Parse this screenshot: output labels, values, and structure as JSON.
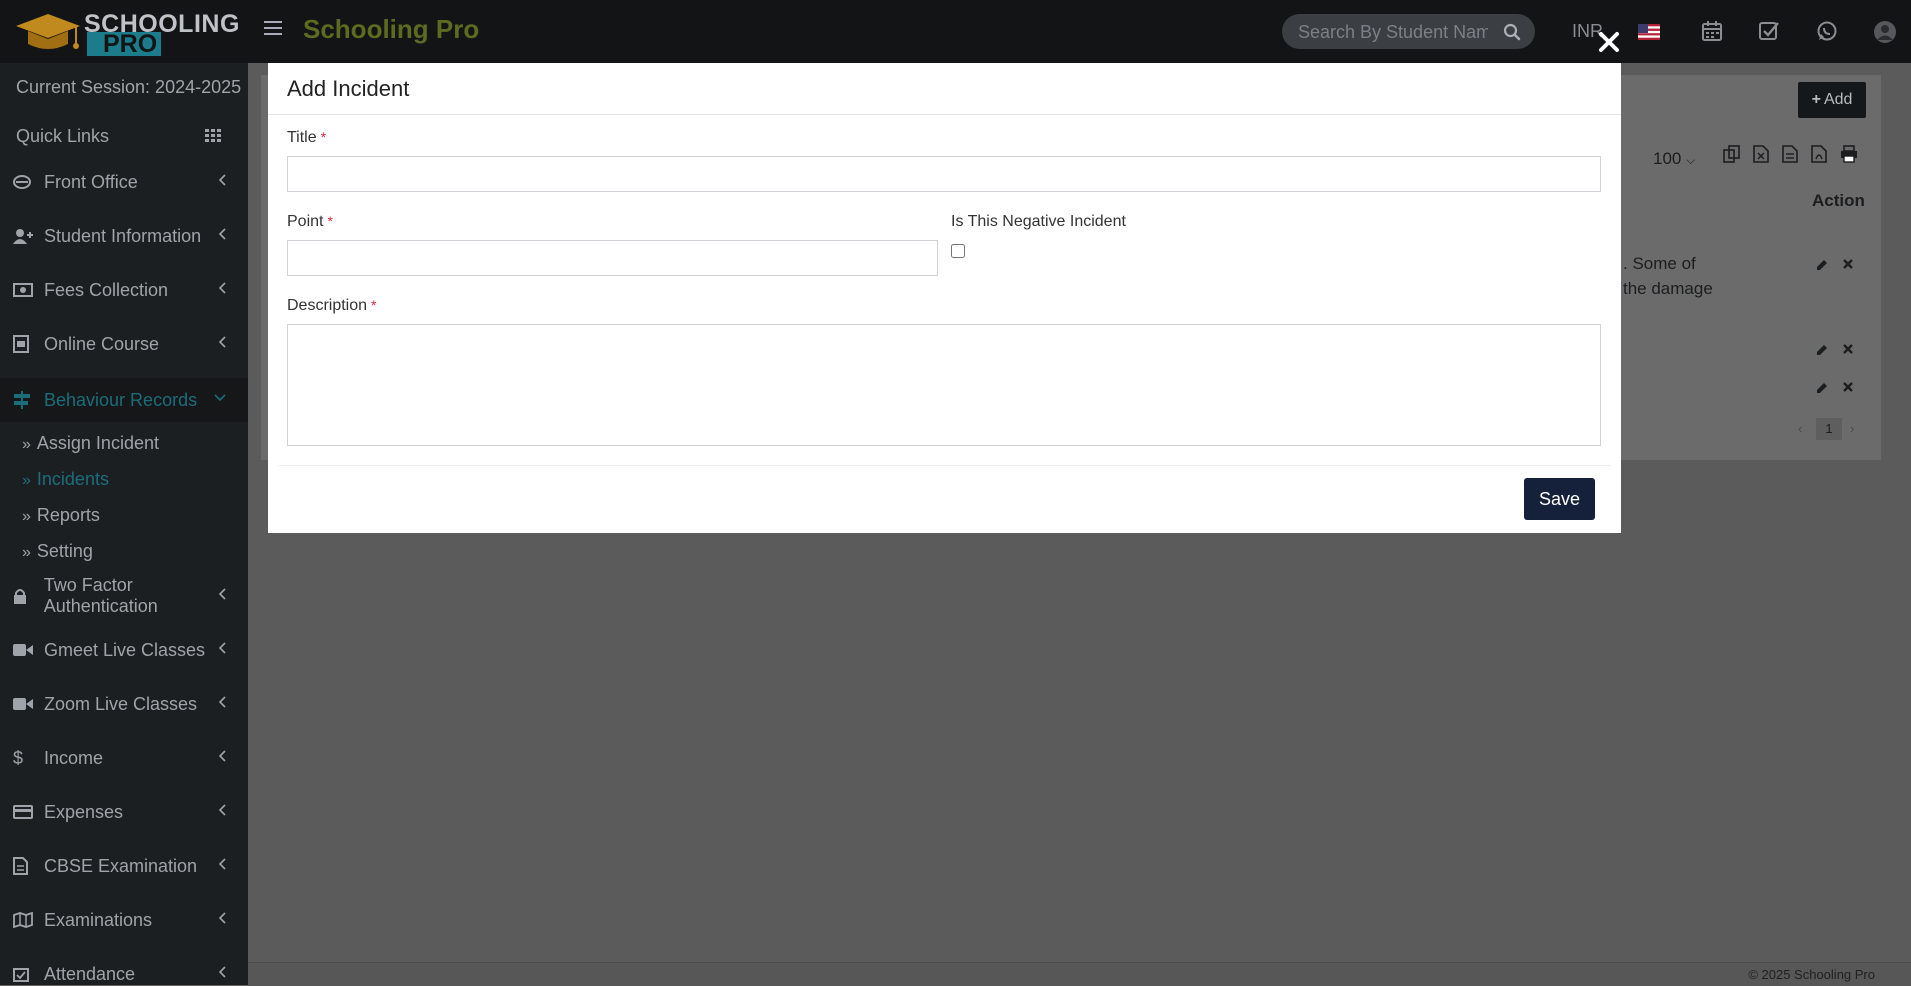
{
  "app": {
    "logo_top": "SCHOOLING",
    "logo_bottom": "PRO",
    "brand": "Schooling Pro"
  },
  "header": {
    "search_placeholder": "Search By Student Name",
    "currency": "INR",
    "icons": [
      "calendar-icon",
      "task-check-icon",
      "whatsapp-icon",
      "user-avatar-icon"
    ]
  },
  "sidebar": {
    "session": "Current Session: 2024-2025",
    "quick_links": "Quick Links",
    "items": [
      {
        "label": "Front Office",
        "icon": "front-office-icon"
      },
      {
        "label": "Student Information",
        "icon": "user-plus-icon"
      },
      {
        "label": "Fees Collection",
        "icon": "money-icon"
      },
      {
        "label": "Online Course",
        "icon": "course-icon"
      },
      {
        "label": "Behaviour Records",
        "icon": "signpost-icon"
      },
      {
        "label": "Two Factor Authentication",
        "icon": "lock-icon"
      },
      {
        "label": "Gmeet Live Classes",
        "icon": "video-icon"
      },
      {
        "label": "Zoom Live Classes",
        "icon": "video-icon"
      },
      {
        "label": "Income",
        "icon": "dollar-icon"
      },
      {
        "label": "Expenses",
        "icon": "credit-card-icon"
      },
      {
        "label": "CBSE Examination",
        "icon": "document-icon"
      },
      {
        "label": "Examinations",
        "icon": "map-icon"
      },
      {
        "label": "Attendance",
        "icon": "calendar-check-icon"
      }
    ],
    "sub_items": [
      "Assign Incident",
      "Incidents",
      "Reports",
      "Setting"
    ],
    "active_item": "Behaviour Records",
    "active_sub_item": "Incidents"
  },
  "background_page": {
    "add_button": "Add",
    "page_size": "100",
    "action_header": "Action",
    "row_text_1": ". Some of",
    "row_text_2": "the damage",
    "pagination_page": "1",
    "footer": "© 2025 Schooling Pro"
  },
  "modal": {
    "title": "Add Incident",
    "fields": {
      "title_label": "Title",
      "title_value": "",
      "point_label": "Point",
      "point_value": "",
      "negative_label": "Is This Negative Incident",
      "negative_checked": false,
      "description_label": "Description",
      "description_value": ""
    },
    "required_marker": "*",
    "save_label": "Save"
  }
}
